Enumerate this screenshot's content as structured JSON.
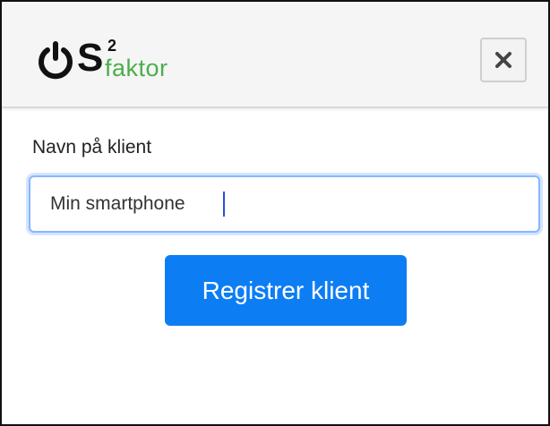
{
  "header": {
    "logo": {
      "text_os": "OS",
      "superscript": "2",
      "text_suffix": "faktor",
      "brand_color_green": "#4cae4c",
      "brand_color_dark": "#111111"
    },
    "close_button": {
      "icon": "close-icon",
      "glyph": "✕"
    }
  },
  "form": {
    "client_name_label": "Navn på klient",
    "client_name_value": "Min smartphone",
    "submit_label": "Registrer klient",
    "accent_color": "#0d7df4",
    "focus_color": "#86b7fe"
  }
}
